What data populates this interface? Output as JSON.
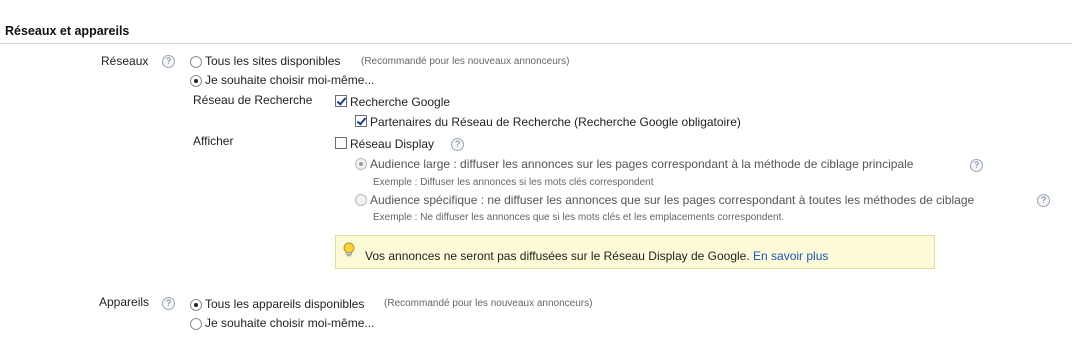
{
  "section_title": "Réseaux et appareils",
  "networks": {
    "label": "Réseaux",
    "options": [
      {
        "text": "Tous les sites disponibles",
        "note": "(Recommandé pour les nouveaux annonceurs)",
        "selected": false
      },
      {
        "text": "Je souhaite choisir moi-même...",
        "note": "",
        "selected": true
      }
    ],
    "search_network": {
      "label": "Réseau de Recherche",
      "items": [
        {
          "text": "Recherche Google",
          "checked": true
        },
        {
          "text": "Partenaires du Réseau de Recherche (Recherche Google obligatoire)",
          "checked": true
        }
      ]
    },
    "display": {
      "label": "Afficher",
      "checkbox": {
        "text": "Réseau Display",
        "checked": false
      },
      "audience_options": [
        {
          "text": "Audience large : diffuser les annonces sur les pages correspondant à la méthode de ciblage principale",
          "example": "Exemple : Diffuser les annonces si les mots clés correspondent",
          "selected": true
        },
        {
          "text": "Audience spécifique : ne diffuser les annonces que sur les pages correspondant à toutes les méthodes de ciblage",
          "example": "Exemple : Ne diffuser les annonces que si les mots clés et les emplacements correspondent.",
          "selected": false
        }
      ]
    },
    "info": {
      "message": "Vos annonces ne seront pas diffusées sur le Réseau Display de Google.",
      "link": "En savoir plus"
    }
  },
  "devices": {
    "label": "Appareils",
    "options": [
      {
        "text": "Tous les appareils disponibles",
        "note": "(Recommandé pour les nouveaux annonceurs)",
        "selected": true
      },
      {
        "text": "Je souhaite choisir moi-même...",
        "note": "",
        "selected": false
      }
    ]
  },
  "help_glyph": "?",
  "colors": {
    "link": "#1a55c0",
    "info_bg": "#fdfbd7",
    "divider": "#c9d3e0"
  }
}
